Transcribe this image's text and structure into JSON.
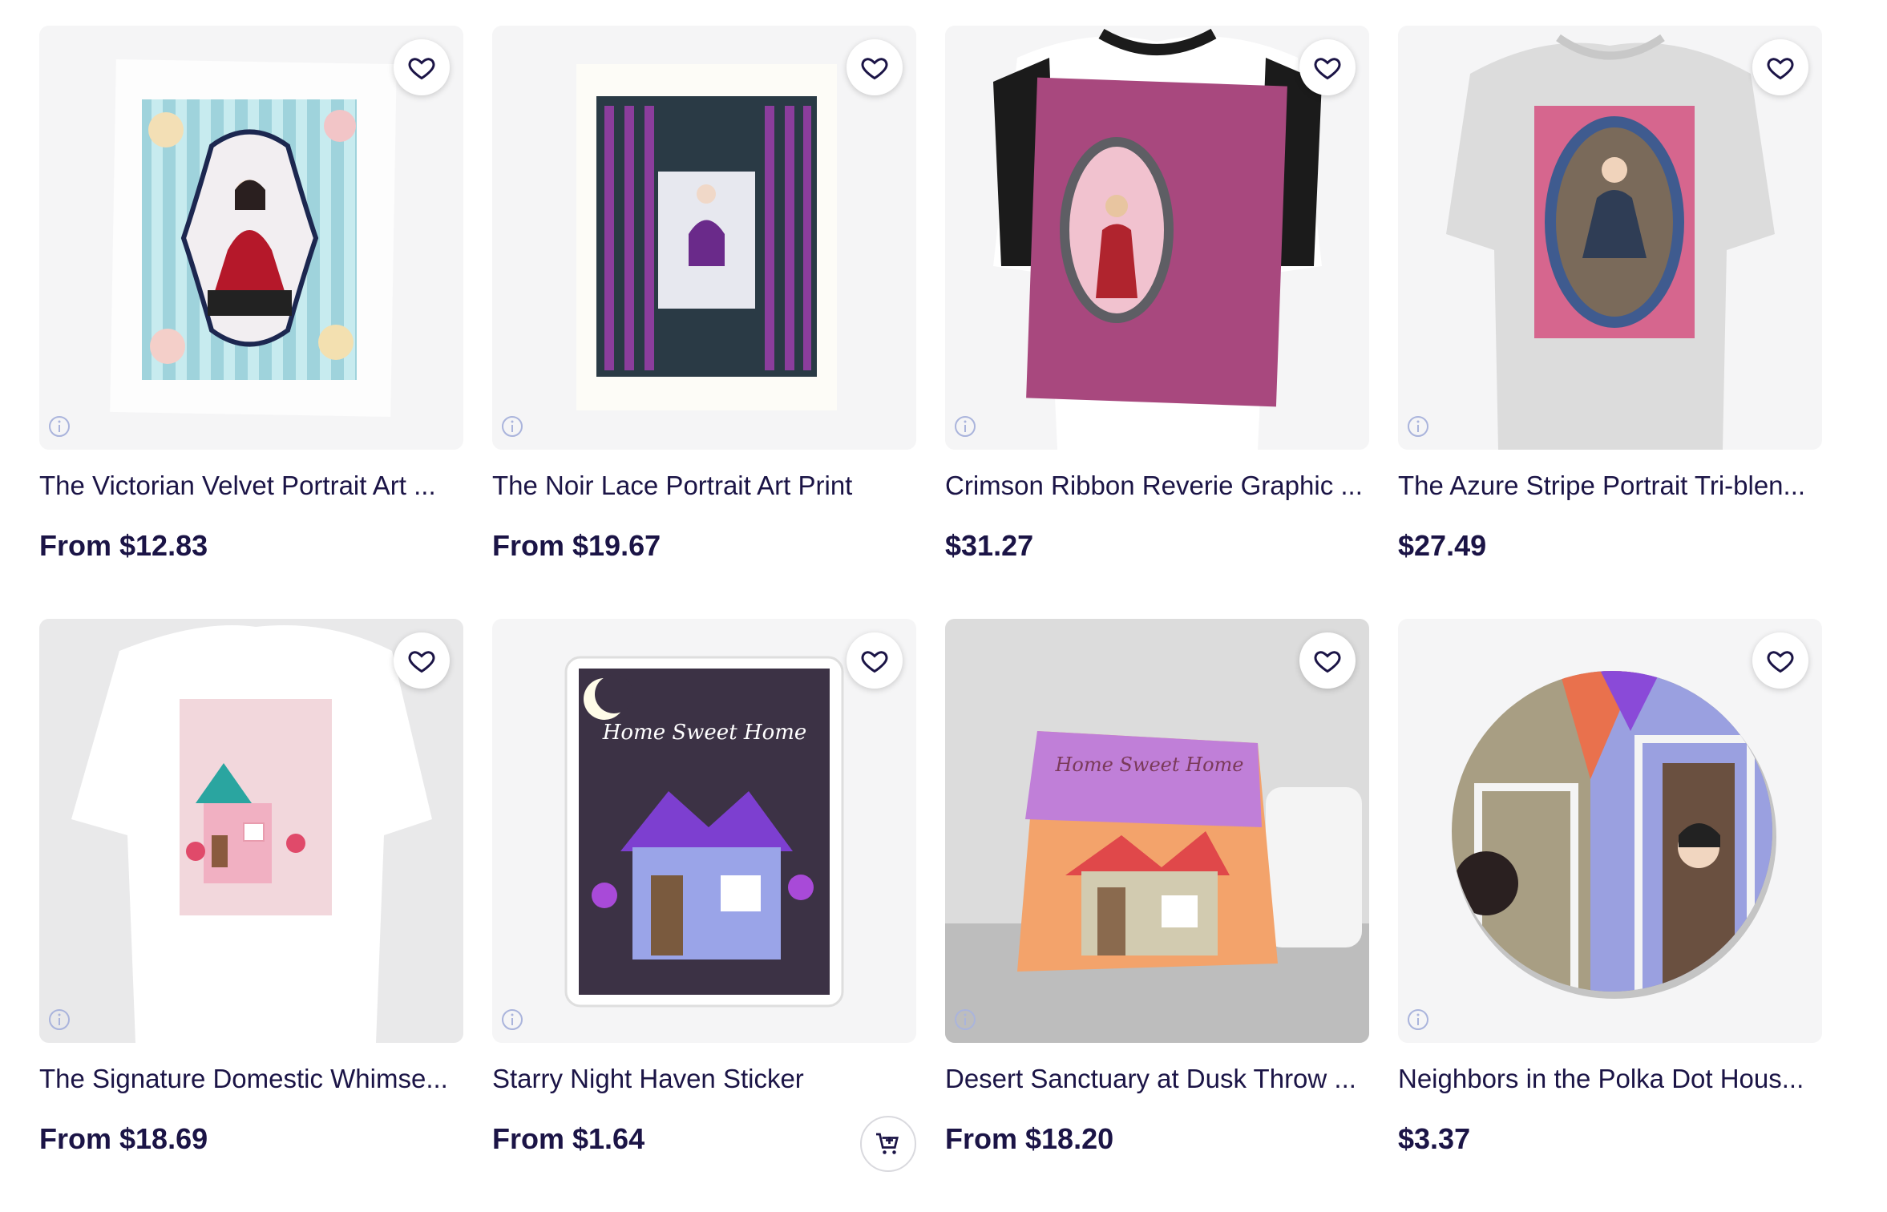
{
  "products": [
    {
      "title": "The Victorian Velvet Portrait Art ...",
      "price": "From $12.83"
    },
    {
      "title": "The Noir Lace Portrait Art Print",
      "price": "From $19.67"
    },
    {
      "title": "Crimson Ribbon Reverie Graphic ...",
      "price": "$31.27"
    },
    {
      "title": "The Azure Stripe Portrait Tri-blen...",
      "price": "$27.49"
    },
    {
      "title": "The Signature Domestic Whimse...",
      "price": "From $18.69"
    },
    {
      "title": "Starry Night Haven Sticker",
      "price": "From $1.64"
    },
    {
      "title": "Desert Sanctuary at Dusk Throw ...",
      "price": "From $18.20"
    },
    {
      "title": "Neighbors in the Polka Dot Hous...",
      "price": "$3.37"
    }
  ],
  "artwork_text": {
    "home_sweet_home": "Home Sweet Home"
  },
  "icons": {
    "favorite": "heart-outline-icon",
    "info": "info-circle-icon",
    "add_to_cart": "cart-plus-icon"
  },
  "colors": {
    "text": "#1b1446",
    "card_bg": "#f5f5f6",
    "info_icon": "#aab4dc"
  }
}
